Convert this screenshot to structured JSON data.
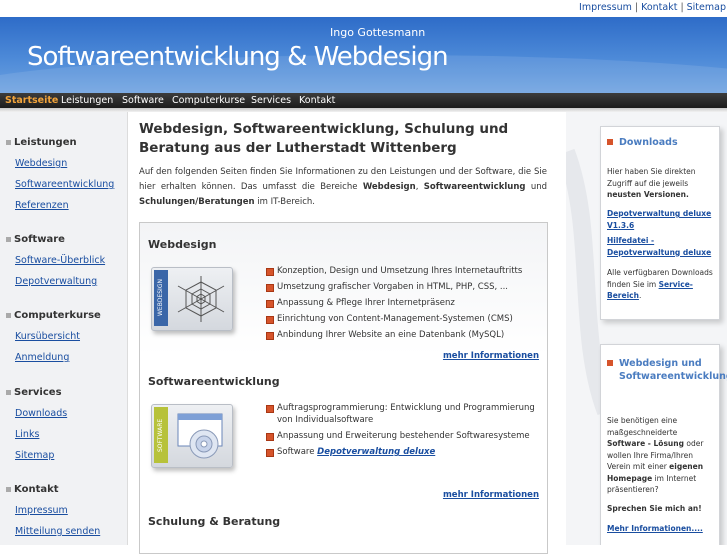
{
  "toplinks": {
    "impressum": "Impressum",
    "kontakt": "Kontakt",
    "sitemap": "Sitemap",
    "sep": "|"
  },
  "header": {
    "owner": "Ingo Gottesmann",
    "brand": "Softwareentwicklung & Webdesign"
  },
  "nav": {
    "items": [
      "Startseite",
      "Leistungen",
      "Software",
      "Computerkurse",
      "Services",
      "Kontakt"
    ]
  },
  "sidebar": {
    "groups": [
      {
        "title": "Leistungen",
        "links": [
          "Webdesign",
          "Softwareentwicklung",
          "Referenzen"
        ]
      },
      {
        "title": "Software",
        "links": [
          "Software-Überblick",
          "Depotverwaltung"
        ]
      },
      {
        "title": "Computerkurse",
        "links": [
          "Kursübersicht",
          "Anmeldung"
        ]
      },
      {
        "title": "Services",
        "links": [
          "Downloads",
          "Links",
          "Sitemap"
        ]
      },
      {
        "title": "Kontakt",
        "links": [
          "Impressum",
          "Mitteilung senden"
        ]
      }
    ]
  },
  "main": {
    "title": "Webdesign, Softwareentwicklung, Schulung und Beratung aus der Lutherstadt Wittenberg",
    "intro": {
      "p1": "Auf den folgenden Seiten finden Sie Informationen zu den Leistungen und der Software, die Sie hier erhalten können. Das umfasst die Bereiche ",
      "b1": "Webdesign",
      "p2": ", ",
      "b2": "Softwareentwicklung",
      "p3": " und ",
      "b3": "Schulungen/Beratungen",
      "p4": " im IT-Bereich."
    },
    "sections": {
      "webdesign": {
        "title": "Webdesign",
        "spine": "WEBDESIGN",
        "bullets": [
          "Konzeption, Design und Umsetzung Ihres Internetauftritts",
          "Umsetzung grafischer Vorgaben in HTML, PHP, CSS, ...",
          "Anpassung & Pflege Ihrer Internetpräsenz",
          "Einrichtung von Content-Management-Systemen (CMS)",
          "Anbindung Ihrer Website an eine Datenbank (MySQL)"
        ],
        "more": "mehr Informationen"
      },
      "software": {
        "title": "Softwareentwicklung",
        "spine": "SOFTWARE",
        "bullets": [
          "Auftragsprogrammierung: Entwicklung und Programmierung von Individualsoftware",
          "Anpassung und Erweiterung bestehender Softwaresysteme"
        ],
        "software_prefix": "Software ",
        "software_link": "Depotverwaltung deluxe",
        "more": "mehr Informationen"
      },
      "schulung": {
        "title": "Schulung & Beratung"
      }
    }
  },
  "right": {
    "downloads": {
      "title": "Downloads",
      "text1": "Hier haben Sie direkten Zugriff auf die jeweils ",
      "text1b": "neusten Versionen.",
      "link1": "Depotverwaltung deluxe V1.3.6",
      "link2": "Hilfedatei - Depotverwaltung deluxe",
      "text2": "Alle verfügbaren Downloads finden Sie im ",
      "link3": "Service-Bereich",
      "text2end": "."
    },
    "webcard": {
      "title": "Webdesign und Softwareentwicklung",
      "text1": "Sie benötigen eine maßgeschneiderte ",
      "bold1": "Software - Lösung",
      "text2": " oder wollen Ihre Firma/Ihren Verein mit einer ",
      "bold2": "eigenen Homepage",
      "text3": " im Internet präsentieren?",
      "cta": "Sprechen Sie mich an!",
      "more": "Mehr Informationen...."
    }
  },
  "colors": {
    "header_blue": "#3a78d0",
    "nav_active": "#f1a33a",
    "bullet": "#d6542b",
    "link": "#1a4ea0"
  }
}
